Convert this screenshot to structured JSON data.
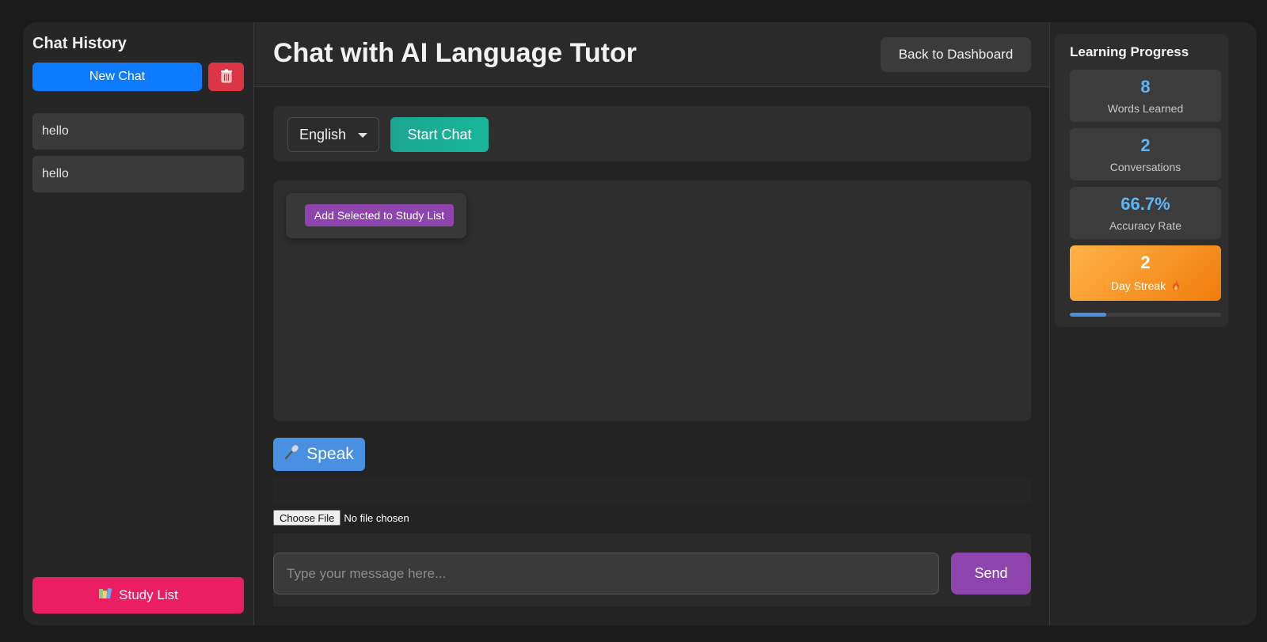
{
  "sidebar": {
    "title": "Chat History",
    "new_chat_label": "New Chat",
    "history": [
      {
        "label": "hello"
      },
      {
        "label": "hello"
      }
    ],
    "study_list_label": "Study List",
    "delete_icon": "trash-icon",
    "study_icon": "books-icon"
  },
  "header": {
    "title": "Chat with AI Language Tutor",
    "back_label": "Back to Dashboard"
  },
  "controls": {
    "language": "English",
    "start_label": "Start Chat"
  },
  "chat": {
    "add_selected_label": "Add Selected to Study List"
  },
  "speak": {
    "label": "Speak",
    "icon": "microphone-icon"
  },
  "file": {
    "button_label": "Choose File",
    "status": "No file chosen"
  },
  "composer": {
    "placeholder": "Type your message here...",
    "send_label": "Send"
  },
  "progress": {
    "title": "Learning Progress",
    "stats": [
      {
        "value": "8",
        "label": "Words Learned"
      },
      {
        "value": "2",
        "label": "Conversations"
      },
      {
        "value": "66.7%",
        "label": "Accuracy Rate"
      }
    ],
    "streak": {
      "value": "2",
      "label": "Day Streak"
    },
    "bar_fraction": 0.24
  },
  "colors": {
    "accent_blue": "#0d7bff",
    "danger_red": "#dc3545",
    "study_pink": "#e91e63",
    "start_teal": "#1aa692",
    "send_purple": "#8e44ad",
    "speak_blue": "#4a90e2",
    "stat_value_blue": "#5fb5f5",
    "streak_orange": "#f07c0c"
  }
}
